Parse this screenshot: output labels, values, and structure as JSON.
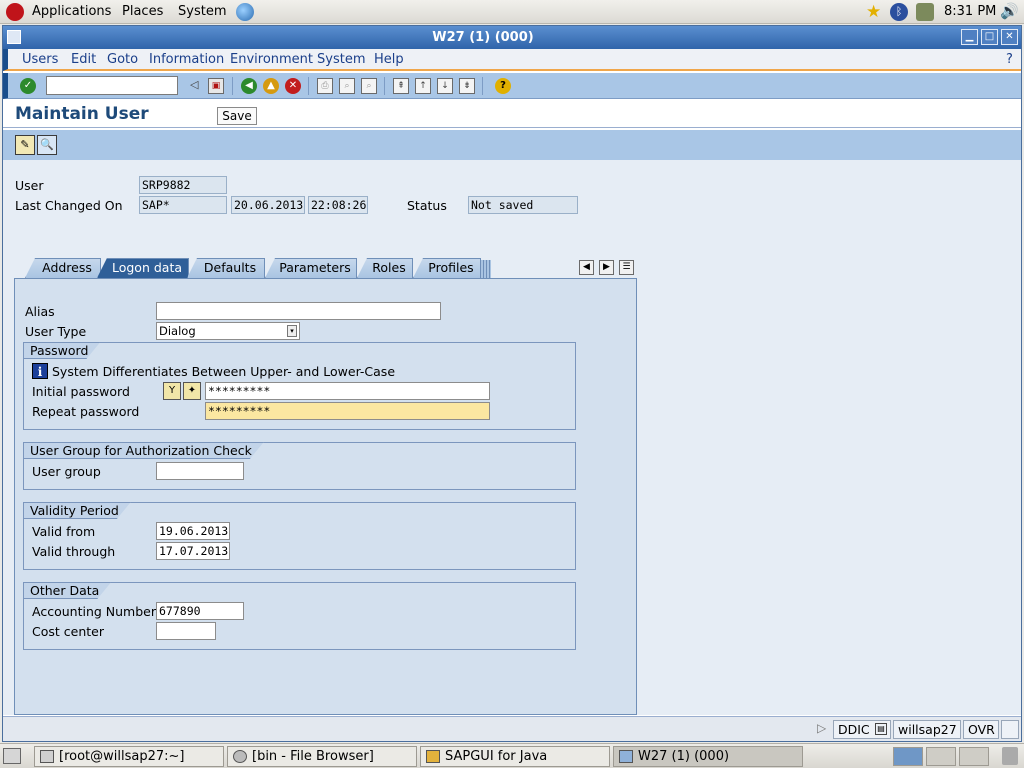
{
  "top_panel": {
    "menus": [
      "Applications",
      "Places",
      "System"
    ],
    "clock": "8:31 PM"
  },
  "window": {
    "title": "W27 (1) (000)",
    "controls": [
      "minimize",
      "maximize",
      "close"
    ]
  },
  "menubar": {
    "items": [
      "Users",
      "Edit",
      "Goto",
      "Information",
      "Environment",
      "System",
      "Help"
    ],
    "help_mark": "?"
  },
  "toolbar": {
    "command_field_value": "",
    "icons": [
      "enter-icon",
      "save-icon",
      "back-icon",
      "exit-icon",
      "cancel-icon",
      "print-icon",
      "find-icon",
      "find-next-icon",
      "first-page-icon",
      "previous-page-icon",
      "next-page-icon",
      "last-page-icon",
      "help-icon"
    ]
  },
  "screen": {
    "title": "Maintain User",
    "save_label": "Save"
  },
  "header": {
    "user_label": "User",
    "user_value": "SRP9882",
    "last_changed_label": "Last Changed On",
    "last_changed_by": "SAP*",
    "last_changed_date": "20.06.2013",
    "last_changed_time": "22:08:26",
    "status_label": "Status",
    "status_value": "Not saved"
  },
  "tabs": [
    {
      "label": "Address",
      "active": false
    },
    {
      "label": "Logon data",
      "active": true
    },
    {
      "label": "Defaults",
      "active": false
    },
    {
      "label": "Parameters",
      "active": false
    },
    {
      "label": "Roles",
      "active": false
    },
    {
      "label": "Profiles",
      "active": false
    }
  ],
  "logon": {
    "alias_label": "Alias",
    "alias_value": "",
    "user_type_label": "User Type",
    "user_type_value": "Dialog",
    "password_group": {
      "title": "Password",
      "info_text": "System Differentiates Between Upper- and Lower-Case",
      "initial_label": "Initial password",
      "initial_value": "*********",
      "repeat_label": "Repeat password",
      "repeat_value": "*********"
    },
    "user_group_group": {
      "title": "User Group for Authorization Check",
      "label": "User group",
      "value": ""
    },
    "validity_group": {
      "title": "Validity Period",
      "from_label": "Valid from",
      "from_value": "19.06.2013",
      "through_label": "Valid through",
      "through_value": "17.07.2013"
    },
    "other_group": {
      "title": "Other Data",
      "accounting_label": "Accounting Number",
      "accounting_value": "677890",
      "cost_center_label": "Cost center",
      "cost_center_value": ""
    }
  },
  "statusbar": {
    "client": "DDIC",
    "server": "willsap27",
    "mode": "OVR"
  },
  "taskbar": {
    "tasks": [
      {
        "label": "[root@willsap27:~]",
        "active": false
      },
      {
        "label": "[bin - File Browser]",
        "active": false
      },
      {
        "label": "SAPGUI for Java",
        "active": false
      },
      {
        "label": "W27 (1) (000)",
        "active": true
      }
    ]
  },
  "colors": {
    "sap_blue": "#2f5f98",
    "toolbar_blue": "#a9c6e6",
    "highlight_field": "#fbe7a1",
    "panel_bg": "#d3e0ee"
  }
}
